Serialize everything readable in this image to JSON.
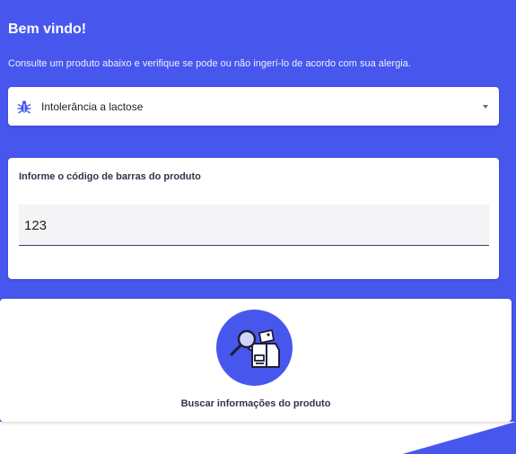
{
  "header": {
    "title": "Bem vindo!",
    "subtitle": "Consulte um produto abaixo e verifique se pode ou não ingerí-lo de acordo com sua alergia."
  },
  "allergy_select": {
    "icon": "bug-icon",
    "selected": "Intolerância a lactose"
  },
  "barcode_card": {
    "label": "Informe o código de barras do produto",
    "value": "123"
  },
  "search_action": {
    "icon": "box-search-icon",
    "label": "Buscar informações do produto"
  },
  "colors": {
    "primary": "#4757ee",
    "card": "#ffffff",
    "text_dark": "#33334a"
  }
}
